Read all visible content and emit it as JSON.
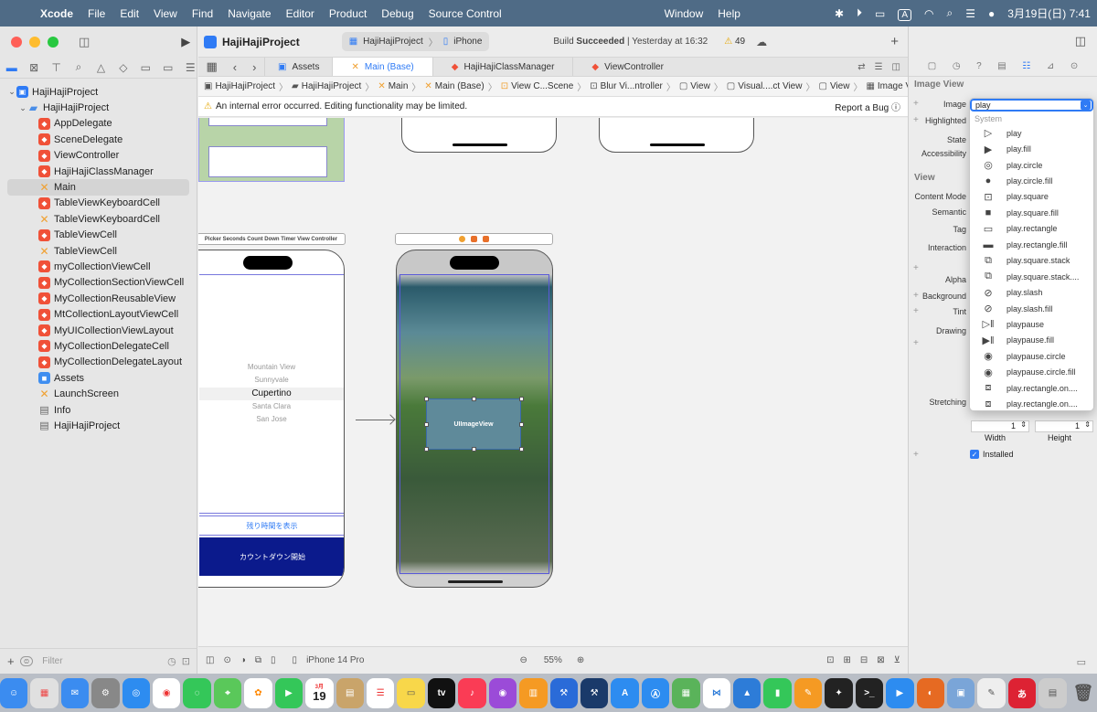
{
  "menubar": {
    "app_name": "Xcode",
    "menus": [
      "File",
      "Edit",
      "View",
      "Find",
      "Navigate",
      "Editor",
      "Product",
      "Debug",
      "Source Control",
      "Window",
      "Help"
    ],
    "input_source": "A",
    "date_time": "3月19日(日)  7:41"
  },
  "window": {
    "project_title": "HajiHajiProject",
    "scheme": {
      "project": "HajiHajiProject",
      "device": "iPhone"
    },
    "build_status_prefix": "Build",
    "build_status_result": "Succeeded",
    "build_status_time": "| Yesterday at 16:32",
    "warning_count": "49"
  },
  "navigator": {
    "filter_placeholder": "Filter",
    "items": [
      {
        "label": "HajiHajiProject",
        "type": "proj",
        "level": 0
      },
      {
        "label": "HajiHajiProject",
        "type": "folder",
        "level": 1
      },
      {
        "label": "AppDelegate",
        "type": "swift",
        "level": 2
      },
      {
        "label": "SceneDelegate",
        "type": "swift",
        "level": 2
      },
      {
        "label": "ViewController",
        "type": "swift",
        "level": 2
      },
      {
        "label": "HajiHajiClassManager",
        "type": "swift",
        "level": 2
      },
      {
        "label": "Main",
        "type": "sb",
        "level": 2,
        "selected": true
      },
      {
        "label": "TableViewKeyboardCell",
        "type": "swift",
        "level": 2
      },
      {
        "label": "TableViewKeyboardCell",
        "type": "sb",
        "level": 2
      },
      {
        "label": "TableViewCell",
        "type": "swift",
        "level": 2
      },
      {
        "label": "TableViewCell",
        "type": "sb",
        "level": 2
      },
      {
        "label": "myCollectionViewCell",
        "type": "swift",
        "level": 2
      },
      {
        "label": "MyCollectionSectionViewCell",
        "type": "swift",
        "level": 2
      },
      {
        "label": "MyCollectionReusableView",
        "type": "swift",
        "level": 2
      },
      {
        "label": "MtCollectionLayoutViewCell",
        "type": "swift",
        "level": 2
      },
      {
        "label": "MyUICollectionViewLayout",
        "type": "swift",
        "level": 2
      },
      {
        "label": "MyCollectionDelegateCell",
        "type": "swift",
        "level": 2
      },
      {
        "label": "MyCollectionDelegateLayout",
        "type": "swift",
        "level": 2
      },
      {
        "label": "Assets",
        "type": "asset",
        "level": 2
      },
      {
        "label": "LaunchScreen",
        "type": "sb",
        "level": 2
      },
      {
        "label": "Info",
        "type": "plist",
        "level": 2
      },
      {
        "label": "HajiHajiProject",
        "type": "plist",
        "level": 2
      }
    ]
  },
  "tabs": [
    {
      "label": "Assets",
      "active": false
    },
    {
      "label": "Main (Base)",
      "active": true
    },
    {
      "label": "HajiHajiClassManager",
      "active": false
    },
    {
      "label": "ViewController",
      "active": false
    }
  ],
  "jumpbar": [
    "HajiHajiProject",
    "HajiHajiProject",
    "Main",
    "Main (Base)",
    "View C...Scene",
    "Blur Vi...ntroller",
    "View",
    "Visual....ct View",
    "View",
    "Image View"
  ],
  "error_bar": {
    "message": "An internal error occurred. Editing functionality may be limited.",
    "report": "Report a Bug"
  },
  "canvas": {
    "scene1_title": "Picker Seconds Count Down Timer View Controller",
    "picker_rows": [
      "Mountain View",
      "Sunnyvale",
      "Cupertino",
      "Santa Clara",
      "San Jose"
    ],
    "remaining_time_button": "残り時間を表示",
    "countdown_button": "カウントダウン開始",
    "image_view_label": "UIImageView",
    "device": "iPhone 14 Pro",
    "zoom": "55%"
  },
  "inspector": {
    "section_image_view": "Image View",
    "image_label": "Image",
    "highlighted_label": "Highlighted",
    "state_label": "State",
    "accessibility_label": "Accessibility",
    "section_view": "View",
    "content_mode_label": "Content Mode",
    "semantic_label": "Semantic",
    "tag_label": "Tag",
    "interaction_label": "Interaction",
    "alpha_label": "Alpha",
    "background_label": "Background",
    "tint_label": "Tint",
    "drawing_label": "Drawing",
    "stretching_label": "Stretching",
    "width_value": "1",
    "height_value": "1",
    "width_label": "Width",
    "height_label": "Height",
    "installed_label": "Installed"
  },
  "image_dropdown": {
    "value": "play",
    "group": "System",
    "items": [
      {
        "label": "play",
        "sym": "▷"
      },
      {
        "label": "play.fill",
        "sym": "▶"
      },
      {
        "label": "play.circle",
        "sym": "◎"
      },
      {
        "label": "play.circle.fill",
        "sym": "●"
      },
      {
        "label": "play.square",
        "sym": "⊡"
      },
      {
        "label": "play.square.fill",
        "sym": "■"
      },
      {
        "label": "play.rectangle",
        "sym": "▭"
      },
      {
        "label": "play.rectangle.fill",
        "sym": "▬"
      },
      {
        "label": "play.square.stack",
        "sym": "⧉"
      },
      {
        "label": "play.square.stack....",
        "sym": "⧉"
      },
      {
        "label": "play.slash",
        "sym": "⊘"
      },
      {
        "label": "play.slash.fill",
        "sym": "⊘"
      },
      {
        "label": "playpause",
        "sym": "▷‖"
      },
      {
        "label": "playpause.fill",
        "sym": "▶‖"
      },
      {
        "label": "playpause.circle",
        "sym": "◉"
      },
      {
        "label": "playpause.circle.fill",
        "sym": "◉"
      },
      {
        "label": "play.rectangle.on....",
        "sym": "⧈"
      },
      {
        "label": "play.rectangle.on....",
        "sym": "⧈"
      }
    ]
  },
  "dock": {
    "calendar_month": "3月",
    "calendar_day": "19",
    "tv_label": "tv",
    "kana_label": "あ"
  },
  "colors": {
    "accent": "#2f7bf5",
    "menubar": "#4f6b86",
    "countdown_button_bg": "#0b1a8c",
    "swift_icon": "#f05138",
    "storyboard_icon": "#f0a030"
  }
}
